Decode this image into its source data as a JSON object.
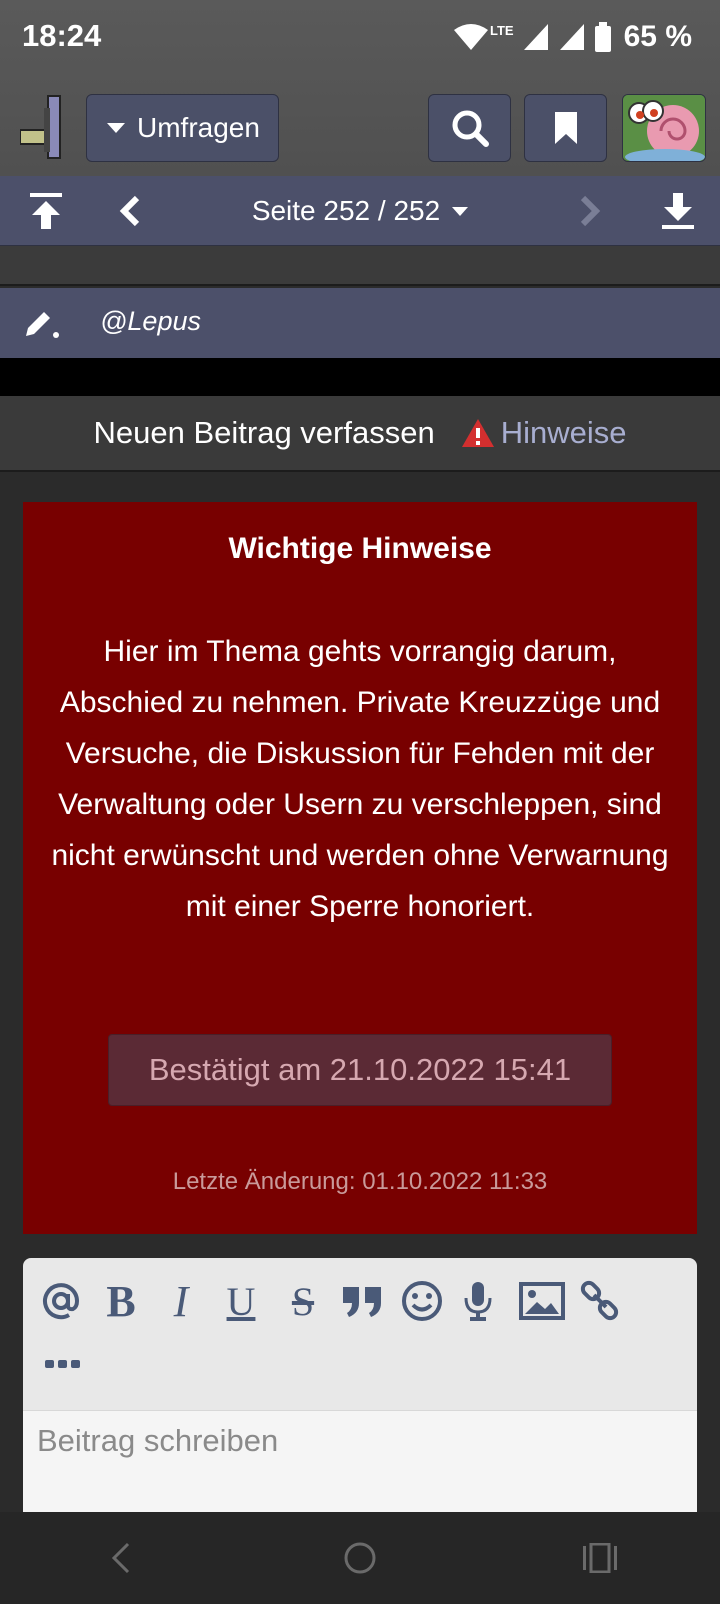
{
  "status_bar": {
    "time": "18:24",
    "network": "LTE",
    "battery": "65 %"
  },
  "header": {
    "dropdown_label": "Umfragen",
    "icons": [
      "logo-icon",
      "search-icon",
      "bookmark-icon",
      "avatar"
    ]
  },
  "pager": {
    "label": "Seite 252 / 252"
  },
  "quick_reply": {
    "mention": "@Lepus"
  },
  "compose": {
    "title": "Neuen Beitrag verfassen",
    "hint_label": "Hinweise"
  },
  "notice": {
    "title": "Wichtige Hinweise",
    "body": "Hier im Thema gehts vorrangig darum, Abschied zu nehmen. Private Kreuzzüge und Versuche, die Diskussion für Fehden mit der Verwaltung oder Usern zu verschleppen, sind nicht erwünscht und werden ohne Verwarnung mit einer Sperre honoriert.",
    "confirm_label": "Bestätigt am 21.10.2022 15:41",
    "last_change": "Letzte Änderung: 01.10.2022 11:33"
  },
  "editor": {
    "toolbar": [
      "at",
      "bold",
      "italic",
      "underline",
      "strikethrough",
      "quote",
      "smiley",
      "microphone",
      "image",
      "link",
      "more"
    ],
    "placeholder": "Beitrag schreiben"
  },
  "colors": {
    "accent": "#4c506a",
    "notice_bg": "#780000",
    "hint_link": "#a8aed0",
    "warning": "#d32f2f"
  }
}
